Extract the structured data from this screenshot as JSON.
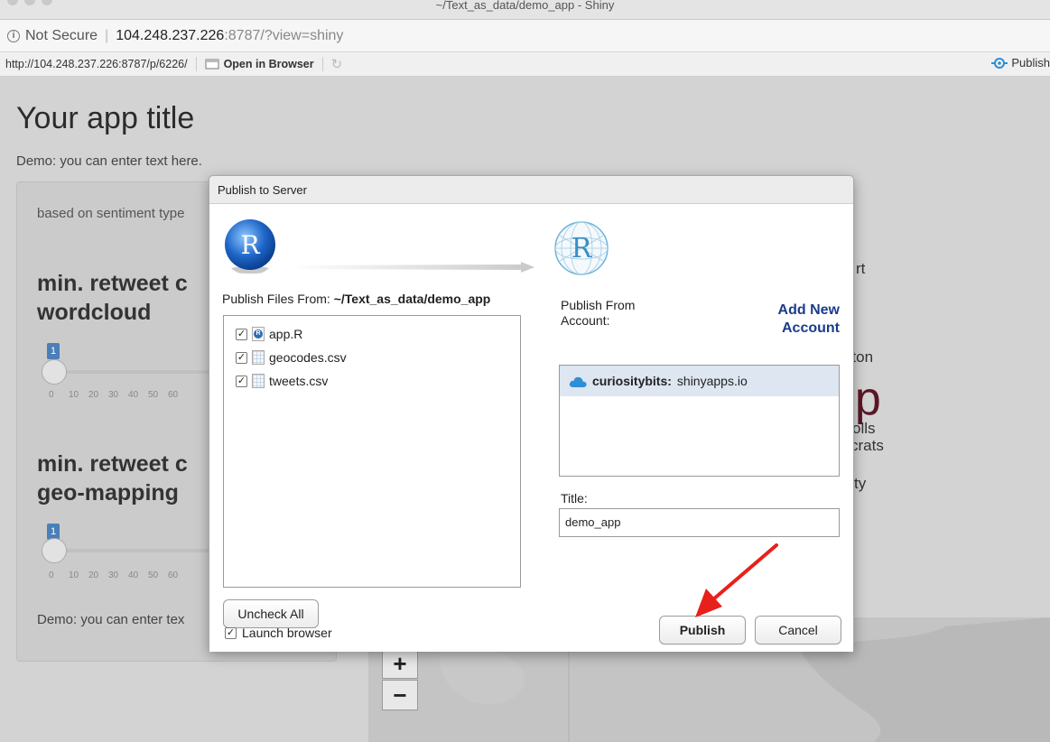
{
  "window": {
    "title": "~/Text_as_data/demo_app - Shiny"
  },
  "address_bar": {
    "not_secure": "Not Secure",
    "host": "104.248.237.226",
    "rest": ":8787/?view=shiny"
  },
  "toolbar": {
    "url": "http://104.248.237.226:8787/p/6226/",
    "open_in_browser": "Open in Browser",
    "publish": "Publish"
  },
  "app": {
    "title": "Your app title",
    "subtitle": "Demo: you can enter text here.",
    "sidebar_text_1": "based on sentiment type",
    "slider1_heading_line1": "min. retweet c",
    "slider1_heading_line2": "wordcloud",
    "slider1_value": "1",
    "slider2_heading_line1": "min. retweet c",
    "slider2_heading_line2": "geo-mapping",
    "slider2_value": "1",
    "ticks": [
      "0",
      "10",
      "20",
      "30",
      "40",
      "50",
      "60"
    ],
    "sidebar_text_2": "Demo: you can enter tex",
    "wordcloud_fragments": [
      "rt",
      "nton",
      "np",
      "olls",
      "crats",
      "ty"
    ],
    "zoom_in": "+",
    "zoom_out": "−"
  },
  "dialog": {
    "title": "Publish to Server",
    "publish_files_from_label": "Publish Files From:",
    "publish_files_from_path": "~/Text_as_data/demo_app",
    "files": [
      {
        "name": "app.R",
        "checked": true,
        "icon": "r-file-icon"
      },
      {
        "name": "geocodes.csv",
        "checked": true,
        "icon": "csv-file-icon"
      },
      {
        "name": "tweets.csv",
        "checked": true,
        "icon": "csv-file-icon"
      }
    ],
    "uncheck_all": "Uncheck All",
    "launch_browser": "Launch browser",
    "publish_from_account_line1": "Publish From",
    "publish_from_account_line2": "Account:",
    "add_new_account_line1": "Add New",
    "add_new_account_line2": "Account",
    "account_name": "curiositybits:",
    "account_server": "shinyapps.io",
    "title_label": "Title:",
    "title_value": "demo_app",
    "publish_button": "Publish",
    "cancel_button": "Cancel",
    "logo_letter": "R"
  },
  "colors": {
    "annotation_arrow": "#e8201c",
    "link_blue": "#1b3c8c",
    "slider_badge": "#4a7fb8"
  }
}
